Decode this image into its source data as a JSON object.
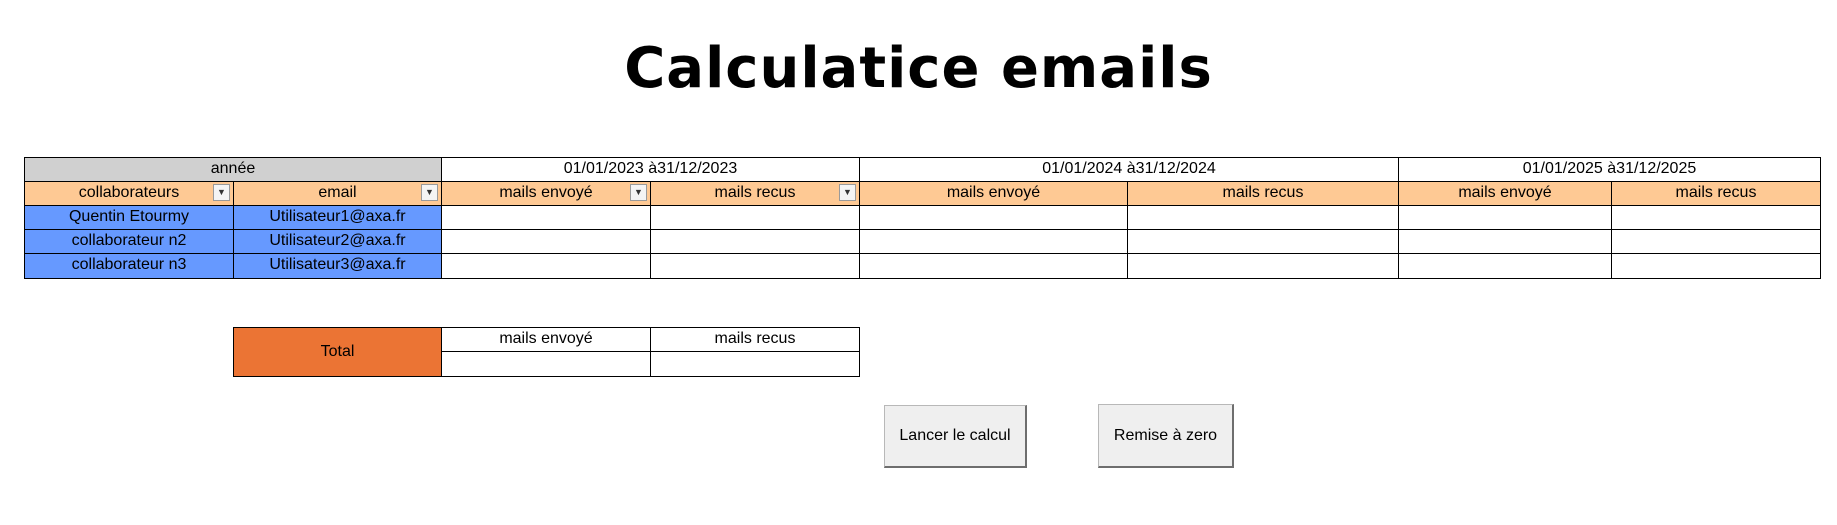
{
  "title": "Calculatice emails",
  "table": {
    "year_label": "année",
    "periods": [
      "01/01/2023 à31/12/2023",
      "01/01/2024 à31/12/2024",
      "01/01/2025 à31/12/2025"
    ],
    "headers": {
      "collaborateurs": "collaborateurs",
      "email": "email",
      "sent": "mails envoyé",
      "received": "mails recus"
    },
    "filter_icon": "chevron-down-icon",
    "rows": [
      {
        "name": "Quentin Etourmy",
        "email": "Utilisateur1@axa.fr"
      },
      {
        "name": "collaborateur n2",
        "email": "Utilisateur2@axa.fr"
      },
      {
        "name": "collaborateur n3",
        "email": "Utilisateur3@axa.fr"
      }
    ]
  },
  "total": {
    "label": "Total",
    "sent_header": "mails envoyé",
    "received_header": "mails recus"
  },
  "buttons": {
    "calc": "Lancer le calcul",
    "reset": "Remise à zero"
  },
  "colors": {
    "header_gray": "#d0d0d0",
    "header_peach": "#fec994",
    "collaborator_blue": "#6699ff",
    "total_orange": "#eb7434"
  }
}
